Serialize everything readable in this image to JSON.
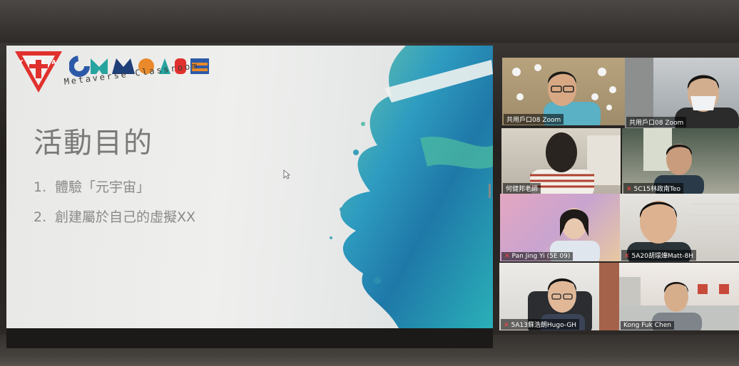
{
  "slide": {
    "logo_text": "Y M C A",
    "brand": "CYMAPS",
    "subtitle": "Metaverse Classroom",
    "title": "活動目的",
    "bullets": [
      {
        "num": "1.",
        "text": "體驗「元宇宙」"
      },
      {
        "num": "2.",
        "text": "創建屬於自己的虛擬XX"
      }
    ]
  },
  "colors": {
    "ymca_red": "#e0312e",
    "brand_blue": "#2c5aa8",
    "brand_orange": "#e9892a",
    "brand_teal": "#27a4a0",
    "active_speaker": "#c6e04a",
    "mute_red": "#ff4040"
  },
  "participants": [
    {
      "name": "共用戶口08 Zoom",
      "muted": false,
      "active": true
    },
    {
      "name": "共用戶口08 Zoom",
      "muted": false,
      "active": false
    },
    {
      "name": "何健邦老師",
      "muted": false,
      "active": false
    },
    {
      "name": "5C15林政南Teo",
      "muted": true,
      "active": false
    },
    {
      "name": "Pan Jing Yi (5E 09)",
      "muted": true,
      "active": false
    },
    {
      "name": "5A20胡璟燁Matt-8H",
      "muted": true,
      "active": false
    },
    {
      "name": "5A13蘇浩朗Hugo-GH",
      "muted": true,
      "active": false
    },
    {
      "name": "Kong Fuk Chen",
      "muted": false,
      "active": false
    }
  ],
  "icons": {
    "mute": "mic-muted-icon",
    "cursor": "mouse-pointer-icon"
  }
}
